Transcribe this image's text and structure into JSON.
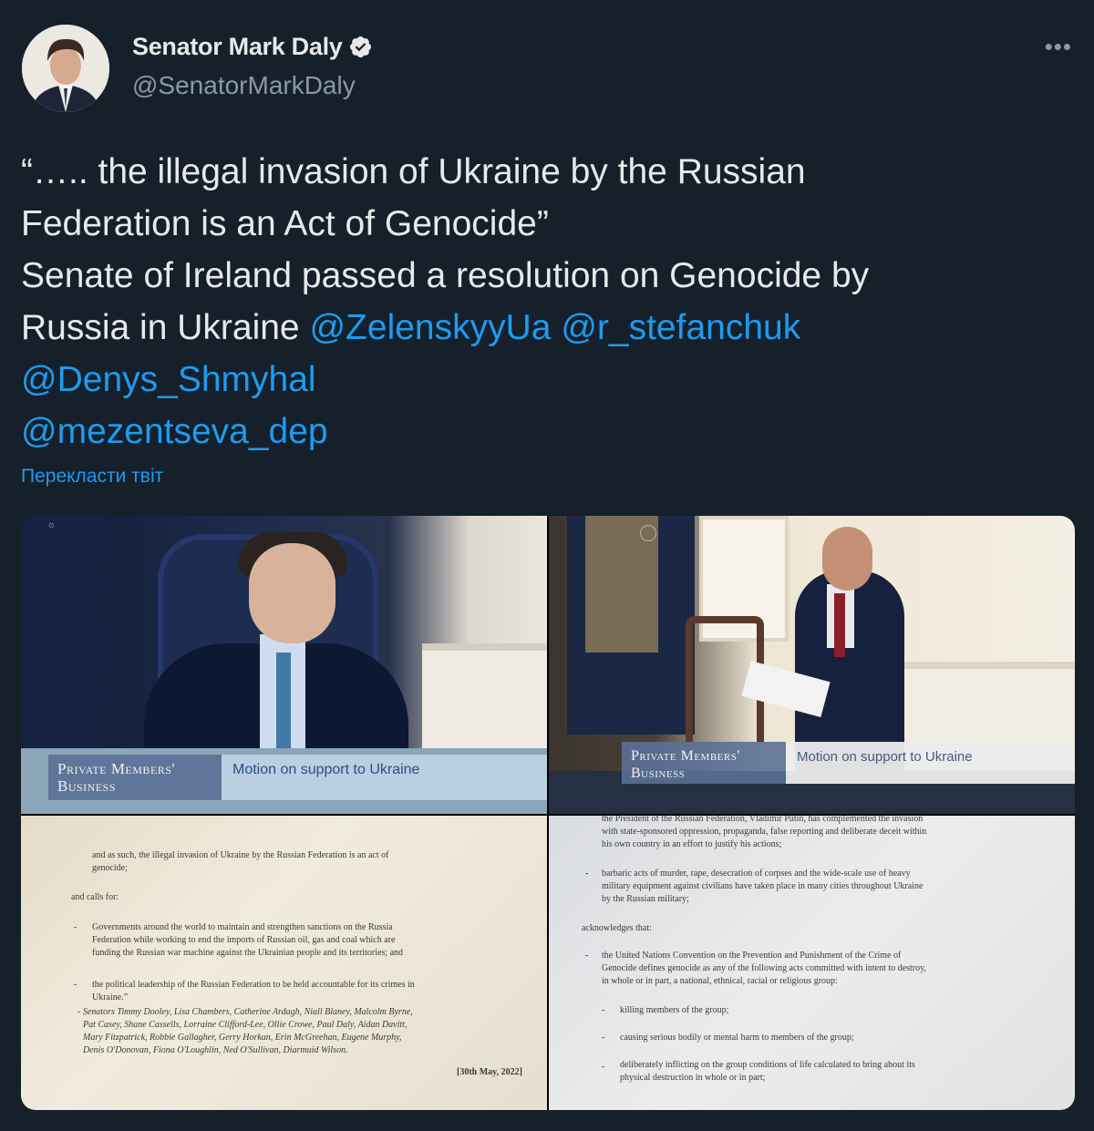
{
  "author": {
    "name": "Senator Mark Daly",
    "handle": "@SenatorMarkDaly",
    "verified": true
  },
  "more_label": "•••",
  "tweet": {
    "quote_line1": "“….. the illegal invasion of Ukraine by the Russian",
    "quote_line2": "Federation is an Act of Genocide”",
    "body_line1": "Senate of Ireland passed a resolution on Genocide by",
    "body_line2": "Russia in Ukraine",
    "mentions": [
      "@ZelenskyyUa",
      "@r_stefanchuk",
      "@Denys_Shmyhal",
      "@mezentseva_dep"
    ]
  },
  "translate_label": "Перекласти твіт",
  "media": {
    "photo1": {
      "banner_tag_line1": "Private Members'",
      "banner_tag_line2": "Business",
      "banner_motion": "Motion on support to Ukraine"
    },
    "photo2": {
      "banner_tag_line1": "Private Members'",
      "banner_tag_line2": "Business",
      "banner_motion": "Motion on support to Ukraine"
    },
    "doc1": {
      "l1": "and as such, the illegal invasion of Ukraine by the Russian Federation is an act of",
      "l2": "genocide;",
      "l3": "and calls for:",
      "l4": "Governments around the world to maintain and strengthen sanctions on the Russia",
      "l5": "Federation while working to end the imports of Russian oil, gas and coal which are",
      "l6": "funding the Russian war machine against the Ukrainian people and its territories; and",
      "l7": "the political leadership of the Russian Federation to be held accountable for its crimes in",
      "l8": "Ukraine.”",
      "l9": "- Senators Timmy Dooley, Lisa Chambers, Catherine Ardagh, Niall Blaney, Malcolm Byrne,",
      "l10": "Pat Casey, Shane Cassells, Lorraine Clifford-Lee, Ollie Crowe, Paul Daly, Aidan Davitt,",
      "l11": "Mary Fitzpatrick, Robbie Gallagher, Gerry Horkan, Erin McGreehan, Eugene Murphy,",
      "l12": "Denis O'Donovan, Fiona O'Loughlin, Ned O'Sullivan, Diarmuid Wilson.",
      "l13": "[30th May, 2022]"
    },
    "doc2": {
      "l1": "the President of the Russian Federation, Vladimir Putin, has complemented the invasion",
      "l2": "with state-sponsored oppression, propaganda, false reporting and deliberate deceit within",
      "l3": "his own country in an effort to justify his actions;",
      "l4": "barbaric acts of murder, rape, desecration of corpses and the wide-scale use of heavy",
      "l5": "military equipment against civilians have taken place in many cities throughout Ukraine",
      "l6": "by the Russian military;",
      "l7": "acknowledges that:",
      "l8": "the United Nations Convention on the Prevention and Punishment of the Crime of",
      "l9": "Genocide defines genocide as any of the following acts committed with intent to destroy,",
      "l10": "in whole or in part, a national, ethnical, racial or religious group:",
      "l11": "killing members of the group;",
      "l12": "causing serious bodily or mental harm to members of the group;",
      "l13": "deliberately inflicting on the group conditions of life calculated to bring about its",
      "l14": "physical destruction in whole or in part;"
    }
  }
}
